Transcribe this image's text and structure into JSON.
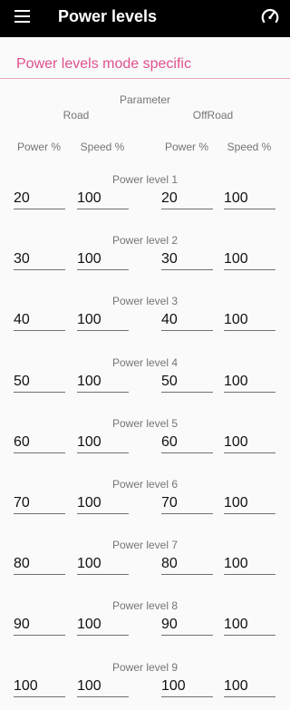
{
  "appbar": {
    "title": "Power levels",
    "menu_icon": "menu-icon",
    "action_icon": "speedometer-icon"
  },
  "section": {
    "title": "Power levels mode specific"
  },
  "headers": {
    "parameter": "Parameter",
    "road": "Road",
    "offroad": "OffRoad",
    "columns": [
      "Power %",
      "Speed %",
      "Power %",
      "Speed %"
    ]
  },
  "levels": [
    {
      "label": "Power level 1",
      "road_power": "20",
      "road_speed": "100",
      "offroad_power": "20",
      "offroad_speed": "100"
    },
    {
      "label": "Power level 2",
      "road_power": "30",
      "road_speed": "100",
      "offroad_power": "30",
      "offroad_speed": "100"
    },
    {
      "label": "Power level 3",
      "road_power": "40",
      "road_speed": "100",
      "offroad_power": "40",
      "offroad_speed": "100"
    },
    {
      "label": "Power level 4",
      "road_power": "50",
      "road_speed": "100",
      "offroad_power": "50",
      "offroad_speed": "100"
    },
    {
      "label": "Power level 5",
      "road_power": "60",
      "road_speed": "100",
      "offroad_power": "60",
      "offroad_speed": "100"
    },
    {
      "label": "Power level 6",
      "road_power": "70",
      "road_speed": "100",
      "offroad_power": "70",
      "offroad_speed": "100"
    },
    {
      "label": "Power level 7",
      "road_power": "80",
      "road_speed": "100",
      "offroad_power": "80",
      "offroad_speed": "100"
    },
    {
      "label": "Power level 8",
      "road_power": "90",
      "road_speed": "100",
      "offroad_power": "90",
      "offroad_speed": "100"
    },
    {
      "label": "Power level 9",
      "road_power": "100",
      "road_speed": "100",
      "offroad_power": "100",
      "offroad_speed": "100"
    }
  ],
  "colors": {
    "appbar_bg": "#000000",
    "accent": "#e0508f",
    "label": "#757575",
    "field_text": "#111111",
    "field_line": "#707070",
    "background": "#fafafa"
  }
}
